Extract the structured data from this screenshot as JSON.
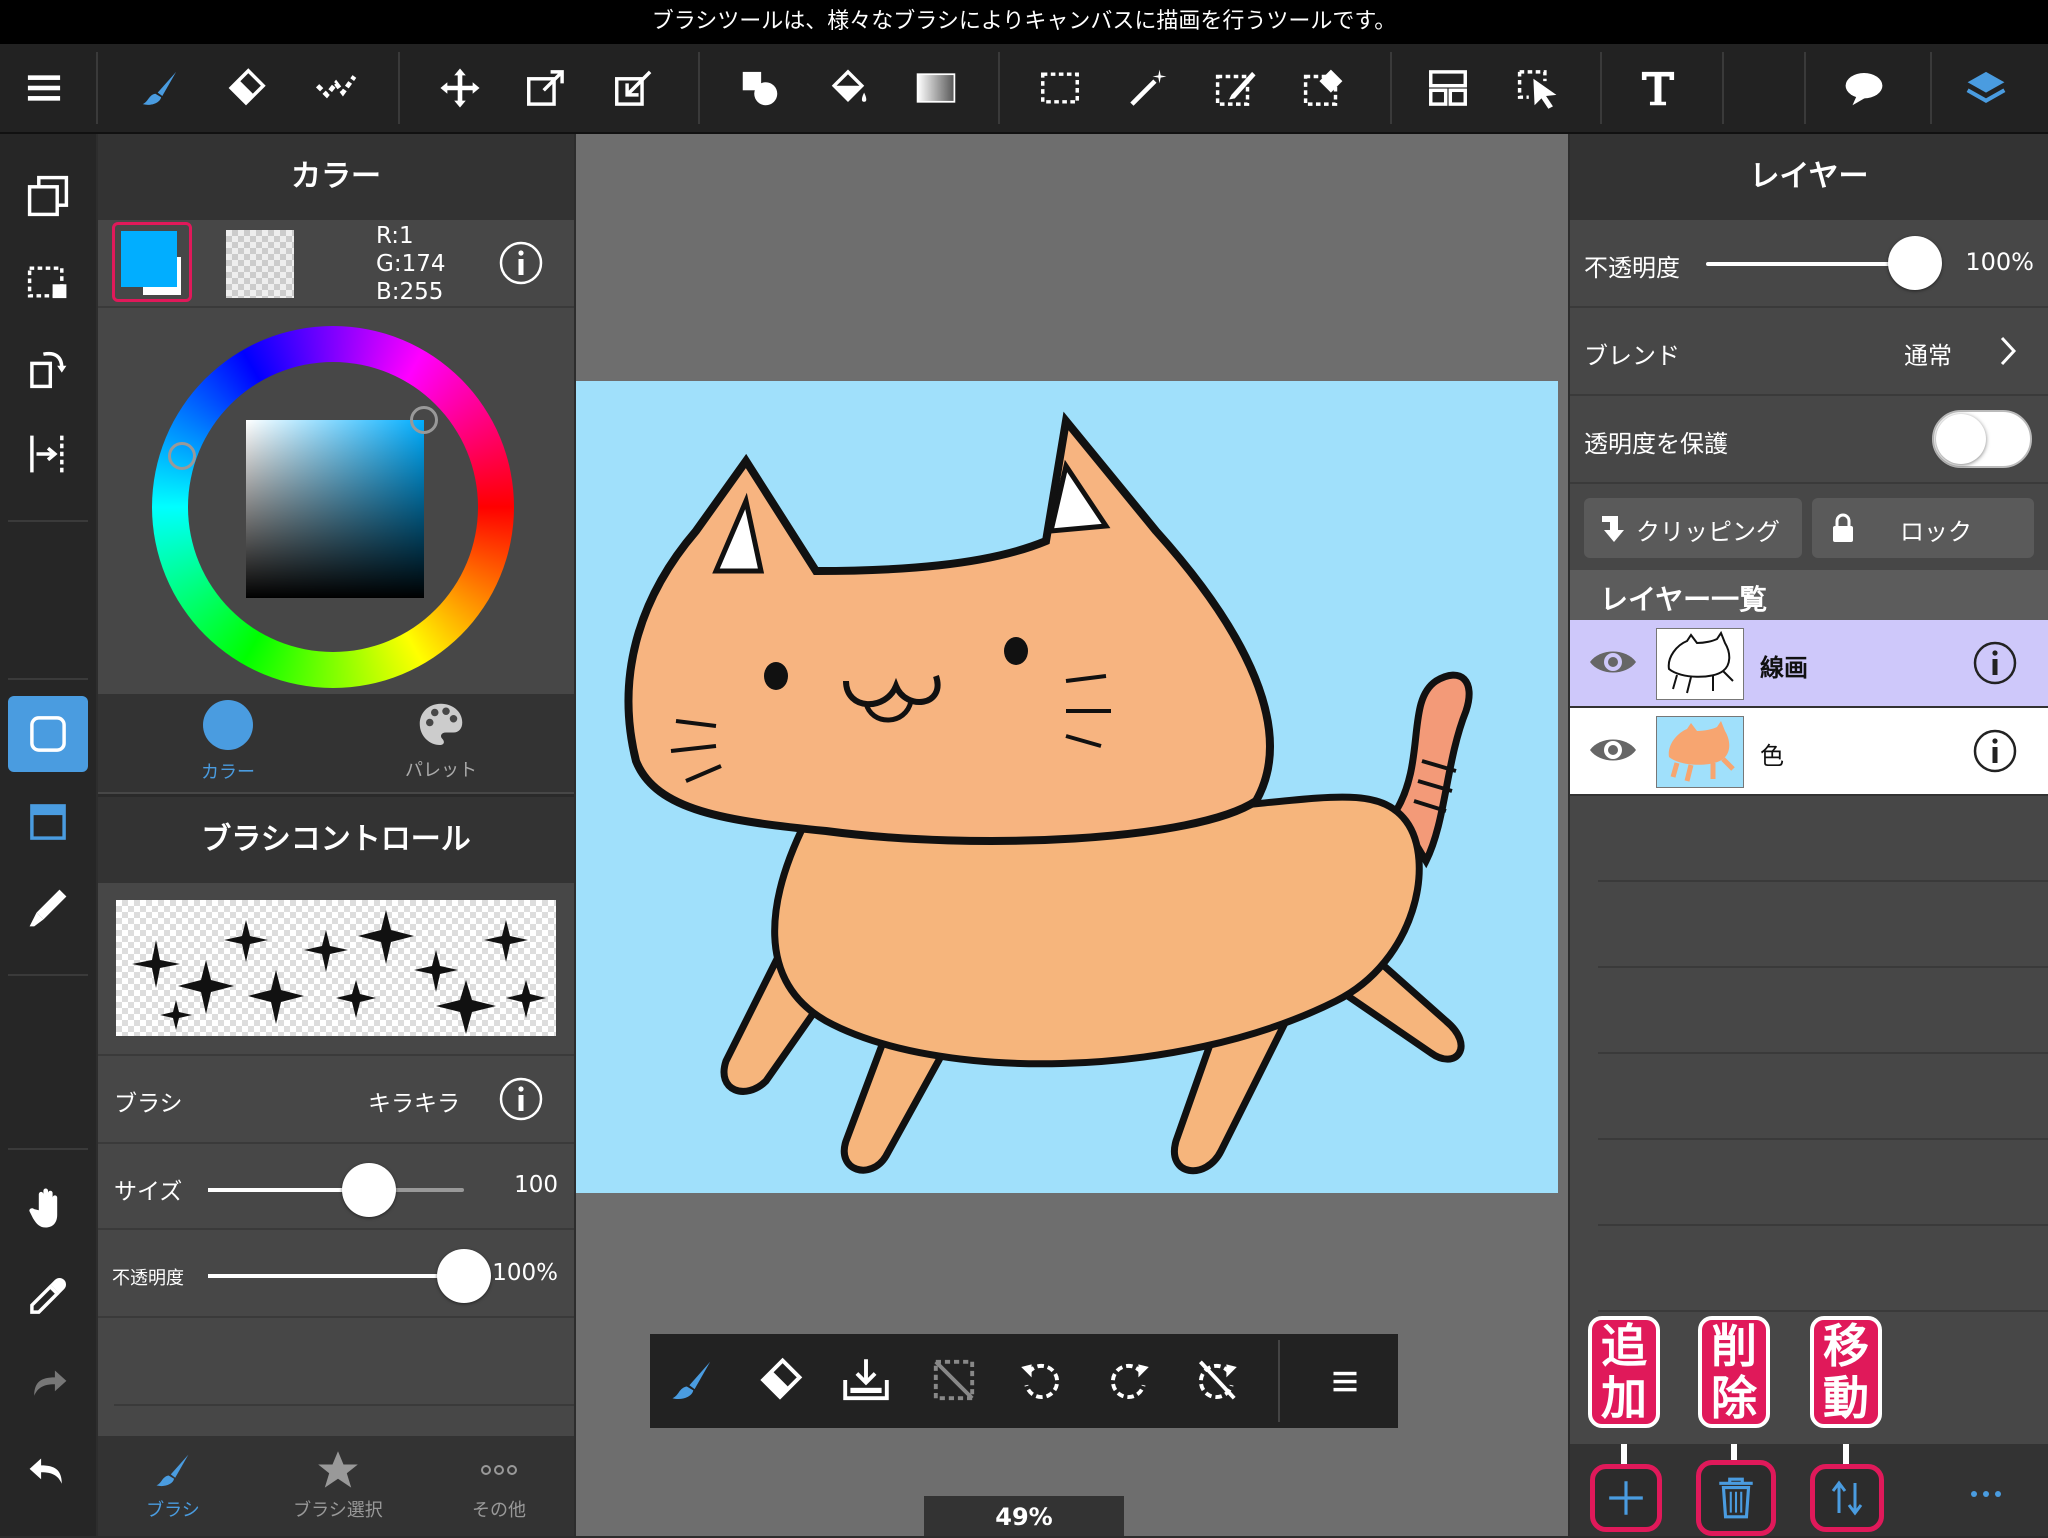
{
  "caption": "ブラシツールは、様々なブラシによりキャンバスに描画を行うツールです。",
  "colors": {
    "accent": "#4a9ce0",
    "current_color": "#01aeff",
    "highlight_pink": "#e0195a",
    "layer_selected": "#cec8fa"
  },
  "toolbar": {
    "icons": [
      "menu-icon",
      "brush-icon",
      "eraser-icon",
      "smudge-icon",
      "move-icon",
      "transform-icon",
      "fit-transform-icon",
      "shape-fill-icon",
      "bucket-icon",
      "gradient-icon",
      "rect-select-icon",
      "magic-wand-icon",
      "select-pen-icon",
      "select-eraser-icon",
      "frame-divider-icon",
      "select-pointer-icon",
      "text-icon",
      "speech-bubble-icon",
      "layers-icon"
    ]
  },
  "color_panel": {
    "title": "カラー",
    "rgb": {
      "r": "R:1",
      "g": "G:174",
      "b": "B:255"
    },
    "tabs": [
      {
        "label": "カラー"
      },
      {
        "label": "パレット"
      }
    ]
  },
  "brush_panel": {
    "title": "ブラシコントロール",
    "brush_label": "ブラシ",
    "brush_value": "キラキラ",
    "size_label": "サイズ",
    "size_value": "100",
    "size_fraction": 0.63,
    "opacity_label": "不透明度",
    "opacity_value": "100%",
    "opacity_fraction": 1.0
  },
  "bottom_tabs": [
    {
      "label": "ブラシ"
    },
    {
      "label": "ブラシ選択"
    },
    {
      "label": "その他"
    }
  ],
  "zoom": "49%",
  "layer_panel": {
    "title": "レイヤー",
    "opacity_label": "不透明度",
    "opacity_value": "100%",
    "blend_label": "ブレンド",
    "blend_value": "通常",
    "protect_label": "透明度を保護",
    "clipping_label": "クリッピング",
    "lock_label": "ロック",
    "list_title": "レイヤー一覧",
    "layers": [
      {
        "name": "線画",
        "selected": true
      },
      {
        "name": "色",
        "selected": false
      }
    ]
  },
  "annotations": {
    "add": "追加",
    "delete": "削除",
    "move": "移動"
  }
}
